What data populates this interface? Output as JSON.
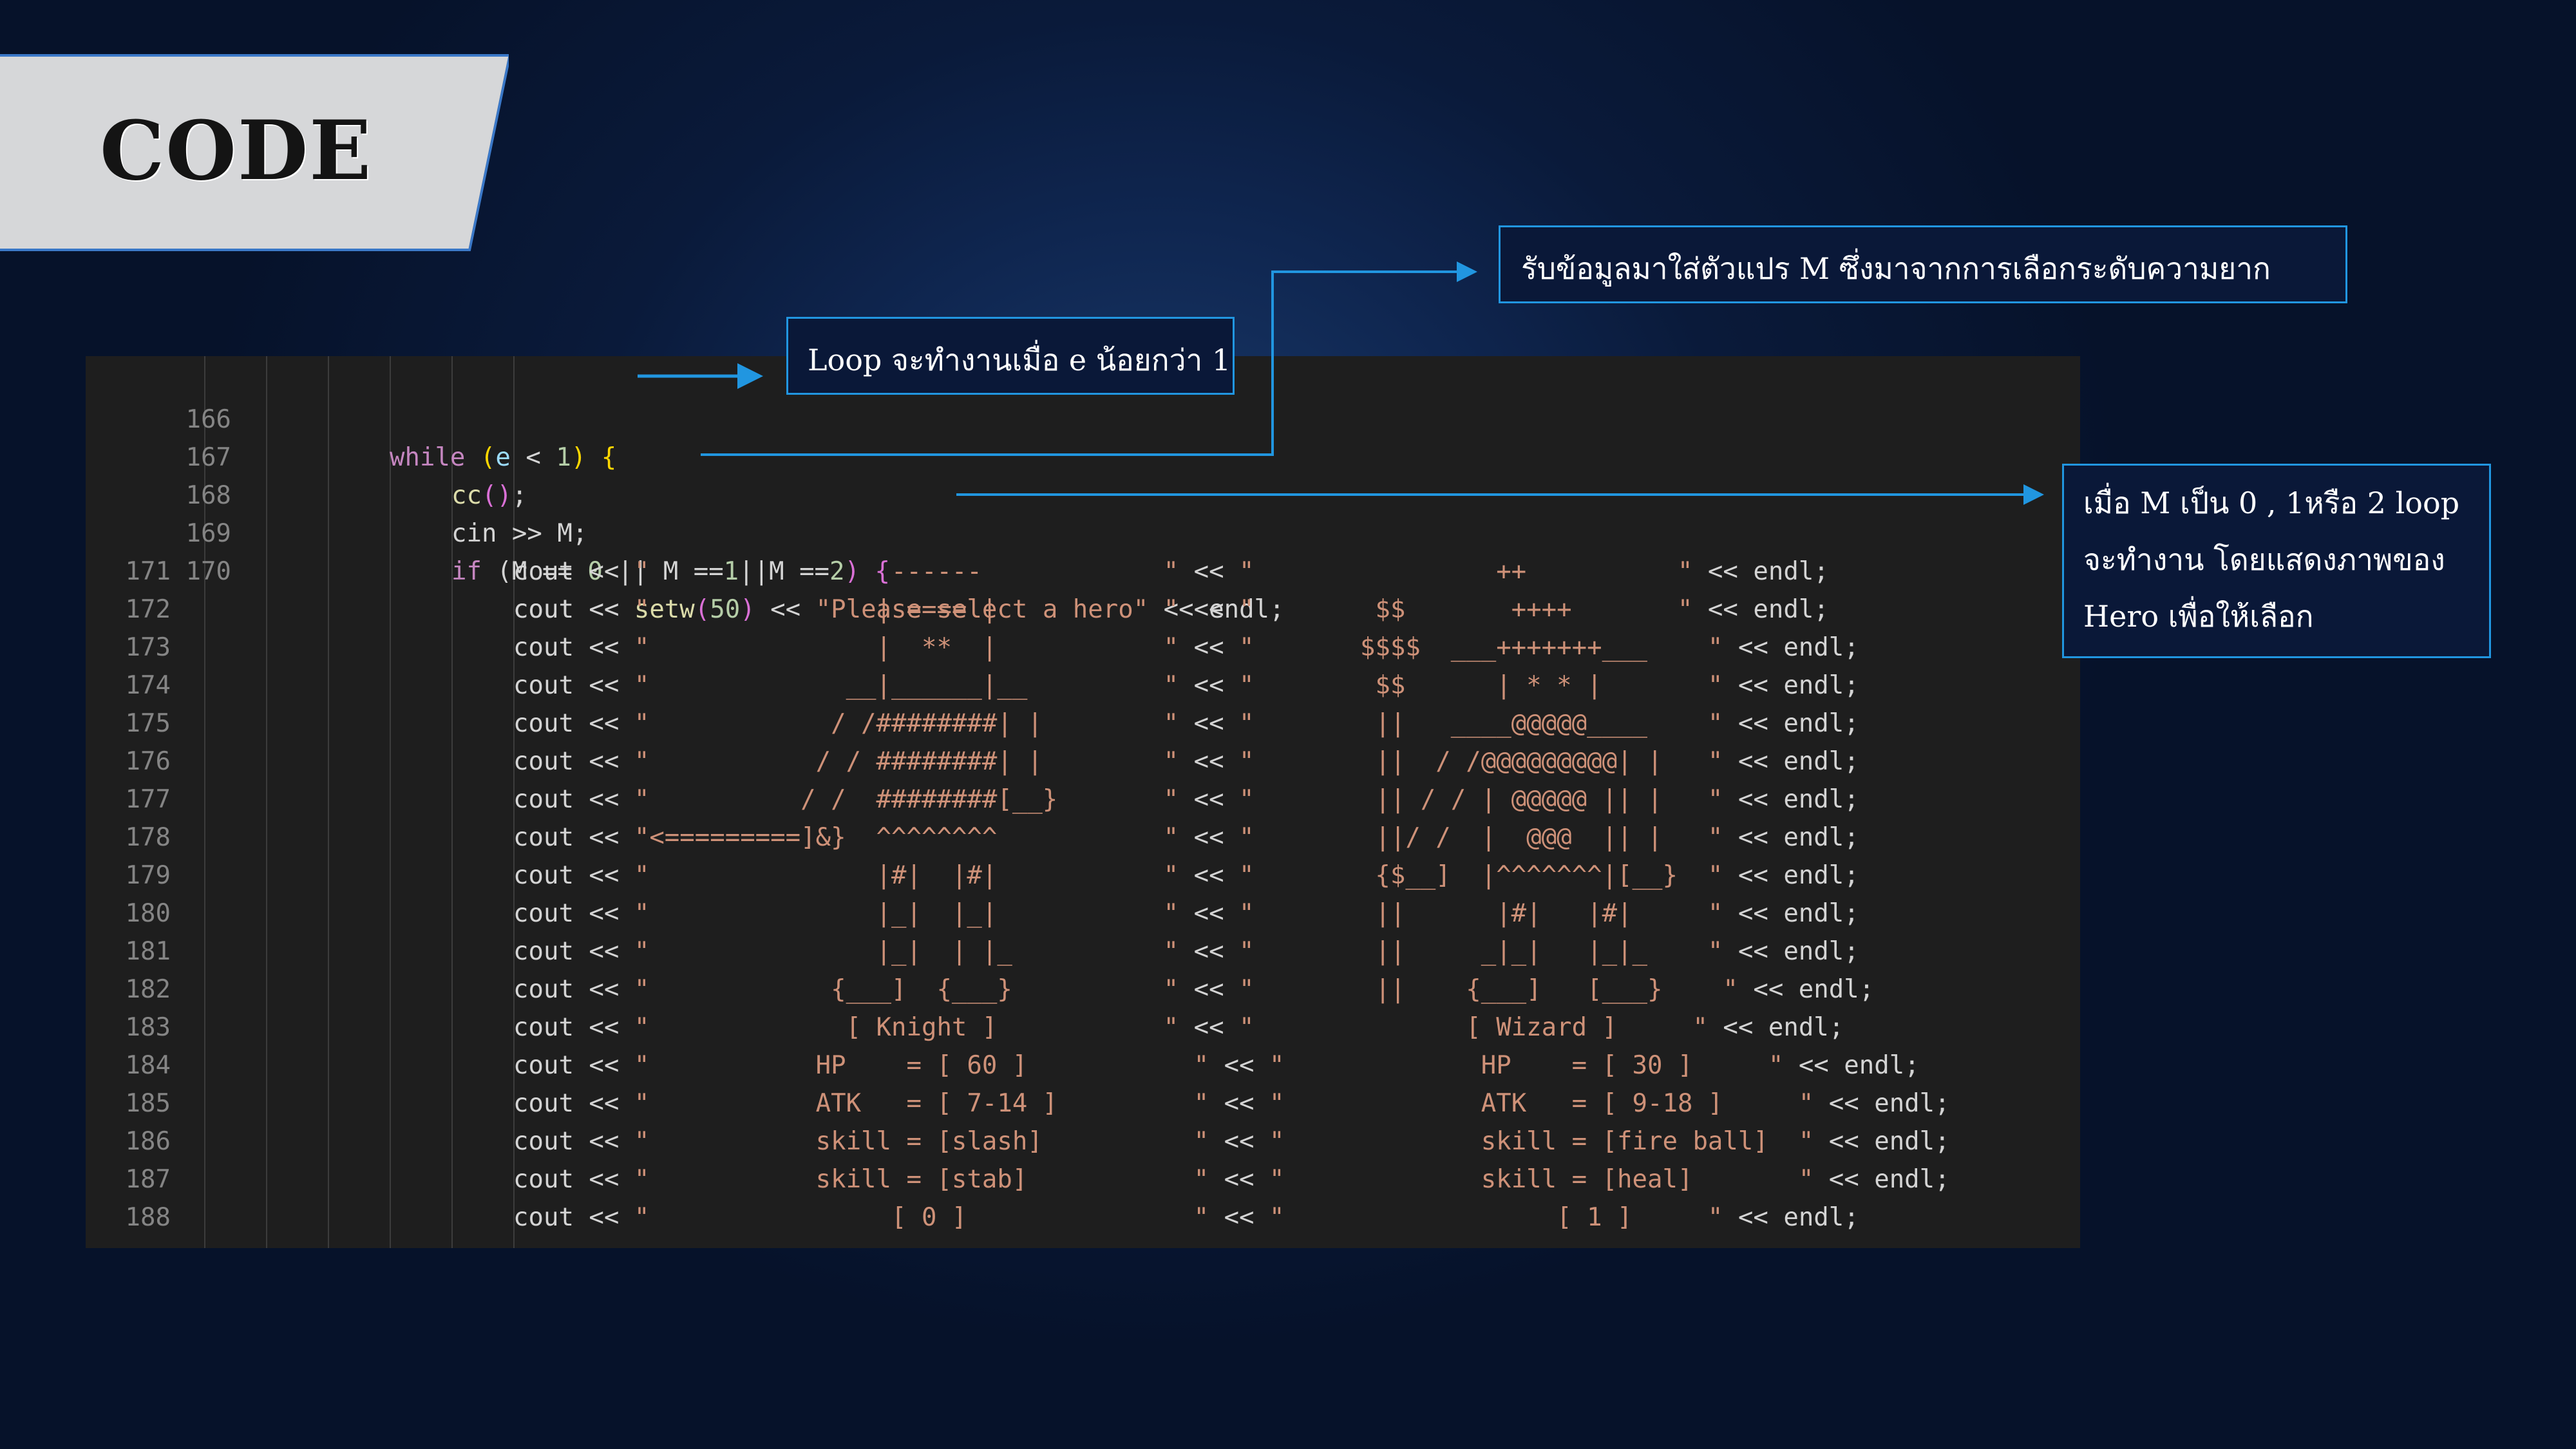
{
  "slide": {
    "title": "CODE"
  },
  "annotations": {
    "loop_note": "Loop จะทำงานเมื่อ e น้อยกว่า 1",
    "input_note": "รับข้อมูลมาใส่ตัวแปร M ซึ่งมาจากการเลือกระดับความยาก",
    "select_note_lines": [
      "เมื่อ M เป็น 0 , 1หรือ 2 loop",
      "จะทำงาน โดยแสดงภาพของ",
      "Hero  เพื่อให้เลือก"
    ]
  },
  "code": {
    "line_numbers": [
      "166",
      "167",
      "168",
      "169",
      "170",
      "171",
      "172",
      "173",
      "174",
      "175",
      "176",
      "177",
      "178",
      "179",
      "180",
      "181",
      "182",
      "183",
      "184",
      "185",
      "186",
      "187",
      "188"
    ],
    "line_166": {
      "kw": "while",
      "open": " (",
      "var": "e",
      "op": " < ",
      "num": "1",
      "close": ")",
      "brace": " {"
    },
    "line_167": {
      "fn": "cc",
      "paren": "()",
      "semi": ";"
    },
    "line_168": {
      "text": "cin >> M;"
    },
    "line_169": {
      "kw": "if",
      "rest_a": " (M == ",
      "n0": "0",
      "rest_b": " || M ==",
      "n1": "1",
      "rest_c": "||M ==",
      "n2": "2",
      "rest_d": ")",
      "brace": " {"
    },
    "line_170": {
      "a": "cout << ",
      "fn": "setw",
      "p1": "(",
      "num": "50",
      "p2": ")",
      "b": " << ",
      "str": "\"Please select a hero\"",
      "c": " << endl;"
    },
    "ascii": [
      {
        "left": "\"                ------            \"",
        "mid": " << ",
        "right": "\"                ++          \"",
        "end": " << endl;"
      },
      {
        "left": "\"               | ==== |           \"",
        "mid": " << ",
        "right": "\"        $$       ++++       \"",
        "end": " << endl;"
      },
      {
        "left": "\"               |  **  |           \"",
        "mid": " << ",
        "right": "\"       $$$$  ___+++++++___    \"",
        "end": " << endl;"
      },
      {
        "left": "\"             __|______|__         \"",
        "mid": " << ",
        "right": "\"        $$      | * * |       \"",
        "end": " << endl;"
      },
      {
        "left": "\"            / /########| |        \"",
        "mid": " << ",
        "right": "\"        ||   ____@@@@@____    \"",
        "end": " << endl;"
      },
      {
        "left": "\"           / / ########| |        \"",
        "mid": " << ",
        "right": "\"        ||  / /@@@@@@@@@| |   \"",
        "end": " << endl;"
      },
      {
        "left": "\"          / /  ########[__}       \"",
        "mid": " << ",
        "right": "\"        || / / | @@@@@ || |   \"",
        "end": " << endl;"
      },
      {
        "left": "\"<=========]&}  ^^^^^^^^           \"",
        "mid": " << ",
        "right": "\"        ||/ /  |  @@@  || |   \"",
        "end": " << endl;"
      },
      {
        "left": "\"               |#|  |#|           \"",
        "mid": " << ",
        "right": "\"        {$__]  |^^^^^^^|[__}  \"",
        "end": " << endl;"
      },
      {
        "left": "\"               |_|  |_|           \"",
        "mid": " << ",
        "right": "\"        ||      |#|   |#|     \"",
        "end": " << endl;"
      },
      {
        "left": "\"               |_|  | |_          \"",
        "mid": " << ",
        "right": "\"        ||     _|_|   |_|_    \"",
        "end": " << endl;"
      },
      {
        "left": "\"            {___]  {___}          \"",
        "mid": " << ",
        "right": "\"        ||    {___]   [___}    \"",
        "end": " << endl;"
      },
      {
        "left": "\"             [ Knight ]           \"",
        "mid": " << ",
        "right": "\"              [ Wizard ]     \"",
        "end": " << endl;"
      },
      {
        "left": "\"           HP    = [ 60 ]           \"",
        "mid": " << ",
        "right": "\"             HP    = [ 30 ]     \"",
        "end": " << endl;"
      },
      {
        "left": "\"           ATK   = [ 7-14 ]         \"",
        "mid": " << ",
        "right": "\"             ATK   = [ 9-18 ]     \"",
        "end": " << endl;"
      },
      {
        "left": "\"           skill = [slash]          \"",
        "mid": " << ",
        "right": "\"             skill = [fire ball]  \"",
        "end": " << endl;"
      },
      {
        "left": "\"           skill = [stab]           \"",
        "mid": " << ",
        "right": "\"             skill = [heal]       \"",
        "end": " << endl;"
      },
      {
        "left": "\"                [ 0 ]               \"",
        "mid": " << ",
        "right": "\"                  [ 1 ]     \"",
        "end": " << endl;"
      }
    ],
    "cout_prefix": "cout << "
  },
  "colors": {
    "keyword": "#c586c0",
    "function": "#dcdcaa",
    "variable": "#9cdcfe",
    "number": "#b5cea8",
    "string": "#ce9178",
    "brace": "#ffd700",
    "annotation_border": "#2196e0"
  }
}
